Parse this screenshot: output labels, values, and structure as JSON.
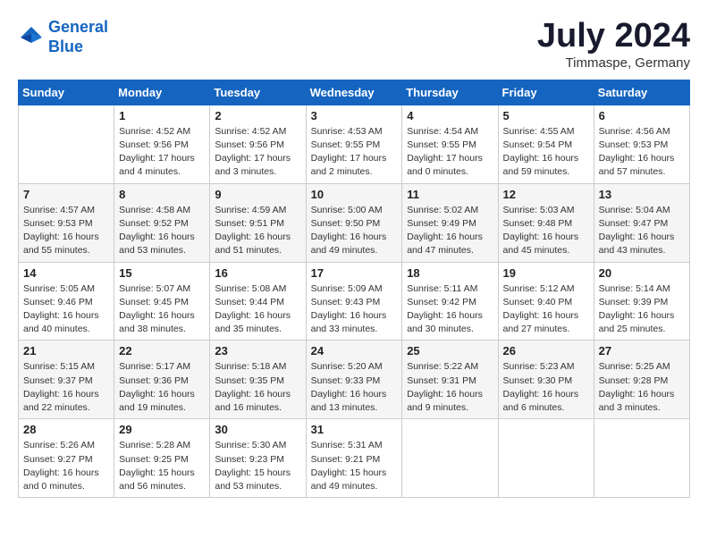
{
  "logo": {
    "line1": "General",
    "line2": "Blue"
  },
  "title": "July 2024",
  "subtitle": "Timmaspe, Germany",
  "weekdays": [
    "Sunday",
    "Monday",
    "Tuesday",
    "Wednesday",
    "Thursday",
    "Friday",
    "Saturday"
  ],
  "weeks": [
    [
      {
        "day": "",
        "info": ""
      },
      {
        "day": "1",
        "info": "Sunrise: 4:52 AM\nSunset: 9:56 PM\nDaylight: 17 hours\nand 4 minutes."
      },
      {
        "day": "2",
        "info": "Sunrise: 4:52 AM\nSunset: 9:56 PM\nDaylight: 17 hours\nand 3 minutes."
      },
      {
        "day": "3",
        "info": "Sunrise: 4:53 AM\nSunset: 9:55 PM\nDaylight: 17 hours\nand 2 minutes."
      },
      {
        "day": "4",
        "info": "Sunrise: 4:54 AM\nSunset: 9:55 PM\nDaylight: 17 hours\nand 0 minutes."
      },
      {
        "day": "5",
        "info": "Sunrise: 4:55 AM\nSunset: 9:54 PM\nDaylight: 16 hours\nand 59 minutes."
      },
      {
        "day": "6",
        "info": "Sunrise: 4:56 AM\nSunset: 9:53 PM\nDaylight: 16 hours\nand 57 minutes."
      }
    ],
    [
      {
        "day": "7",
        "info": "Sunrise: 4:57 AM\nSunset: 9:53 PM\nDaylight: 16 hours\nand 55 minutes."
      },
      {
        "day": "8",
        "info": "Sunrise: 4:58 AM\nSunset: 9:52 PM\nDaylight: 16 hours\nand 53 minutes."
      },
      {
        "day": "9",
        "info": "Sunrise: 4:59 AM\nSunset: 9:51 PM\nDaylight: 16 hours\nand 51 minutes."
      },
      {
        "day": "10",
        "info": "Sunrise: 5:00 AM\nSunset: 9:50 PM\nDaylight: 16 hours\nand 49 minutes."
      },
      {
        "day": "11",
        "info": "Sunrise: 5:02 AM\nSunset: 9:49 PM\nDaylight: 16 hours\nand 47 minutes."
      },
      {
        "day": "12",
        "info": "Sunrise: 5:03 AM\nSunset: 9:48 PM\nDaylight: 16 hours\nand 45 minutes."
      },
      {
        "day": "13",
        "info": "Sunrise: 5:04 AM\nSunset: 9:47 PM\nDaylight: 16 hours\nand 43 minutes."
      }
    ],
    [
      {
        "day": "14",
        "info": "Sunrise: 5:05 AM\nSunset: 9:46 PM\nDaylight: 16 hours\nand 40 minutes."
      },
      {
        "day": "15",
        "info": "Sunrise: 5:07 AM\nSunset: 9:45 PM\nDaylight: 16 hours\nand 38 minutes."
      },
      {
        "day": "16",
        "info": "Sunrise: 5:08 AM\nSunset: 9:44 PM\nDaylight: 16 hours\nand 35 minutes."
      },
      {
        "day": "17",
        "info": "Sunrise: 5:09 AM\nSunset: 9:43 PM\nDaylight: 16 hours\nand 33 minutes."
      },
      {
        "day": "18",
        "info": "Sunrise: 5:11 AM\nSunset: 9:42 PM\nDaylight: 16 hours\nand 30 minutes."
      },
      {
        "day": "19",
        "info": "Sunrise: 5:12 AM\nSunset: 9:40 PM\nDaylight: 16 hours\nand 27 minutes."
      },
      {
        "day": "20",
        "info": "Sunrise: 5:14 AM\nSunset: 9:39 PM\nDaylight: 16 hours\nand 25 minutes."
      }
    ],
    [
      {
        "day": "21",
        "info": "Sunrise: 5:15 AM\nSunset: 9:37 PM\nDaylight: 16 hours\nand 22 minutes."
      },
      {
        "day": "22",
        "info": "Sunrise: 5:17 AM\nSunset: 9:36 PM\nDaylight: 16 hours\nand 19 minutes."
      },
      {
        "day": "23",
        "info": "Sunrise: 5:18 AM\nSunset: 9:35 PM\nDaylight: 16 hours\nand 16 minutes."
      },
      {
        "day": "24",
        "info": "Sunrise: 5:20 AM\nSunset: 9:33 PM\nDaylight: 16 hours\nand 13 minutes."
      },
      {
        "day": "25",
        "info": "Sunrise: 5:22 AM\nSunset: 9:31 PM\nDaylight: 16 hours\nand 9 minutes."
      },
      {
        "day": "26",
        "info": "Sunrise: 5:23 AM\nSunset: 9:30 PM\nDaylight: 16 hours\nand 6 minutes."
      },
      {
        "day": "27",
        "info": "Sunrise: 5:25 AM\nSunset: 9:28 PM\nDaylight: 16 hours\nand 3 minutes."
      }
    ],
    [
      {
        "day": "28",
        "info": "Sunrise: 5:26 AM\nSunset: 9:27 PM\nDaylight: 16 hours\nand 0 minutes."
      },
      {
        "day": "29",
        "info": "Sunrise: 5:28 AM\nSunset: 9:25 PM\nDaylight: 15 hours\nand 56 minutes."
      },
      {
        "day": "30",
        "info": "Sunrise: 5:30 AM\nSunset: 9:23 PM\nDaylight: 15 hours\nand 53 minutes."
      },
      {
        "day": "31",
        "info": "Sunrise: 5:31 AM\nSunset: 9:21 PM\nDaylight: 15 hours\nand 49 minutes."
      },
      {
        "day": "",
        "info": ""
      },
      {
        "day": "",
        "info": ""
      },
      {
        "day": "",
        "info": ""
      }
    ]
  ]
}
